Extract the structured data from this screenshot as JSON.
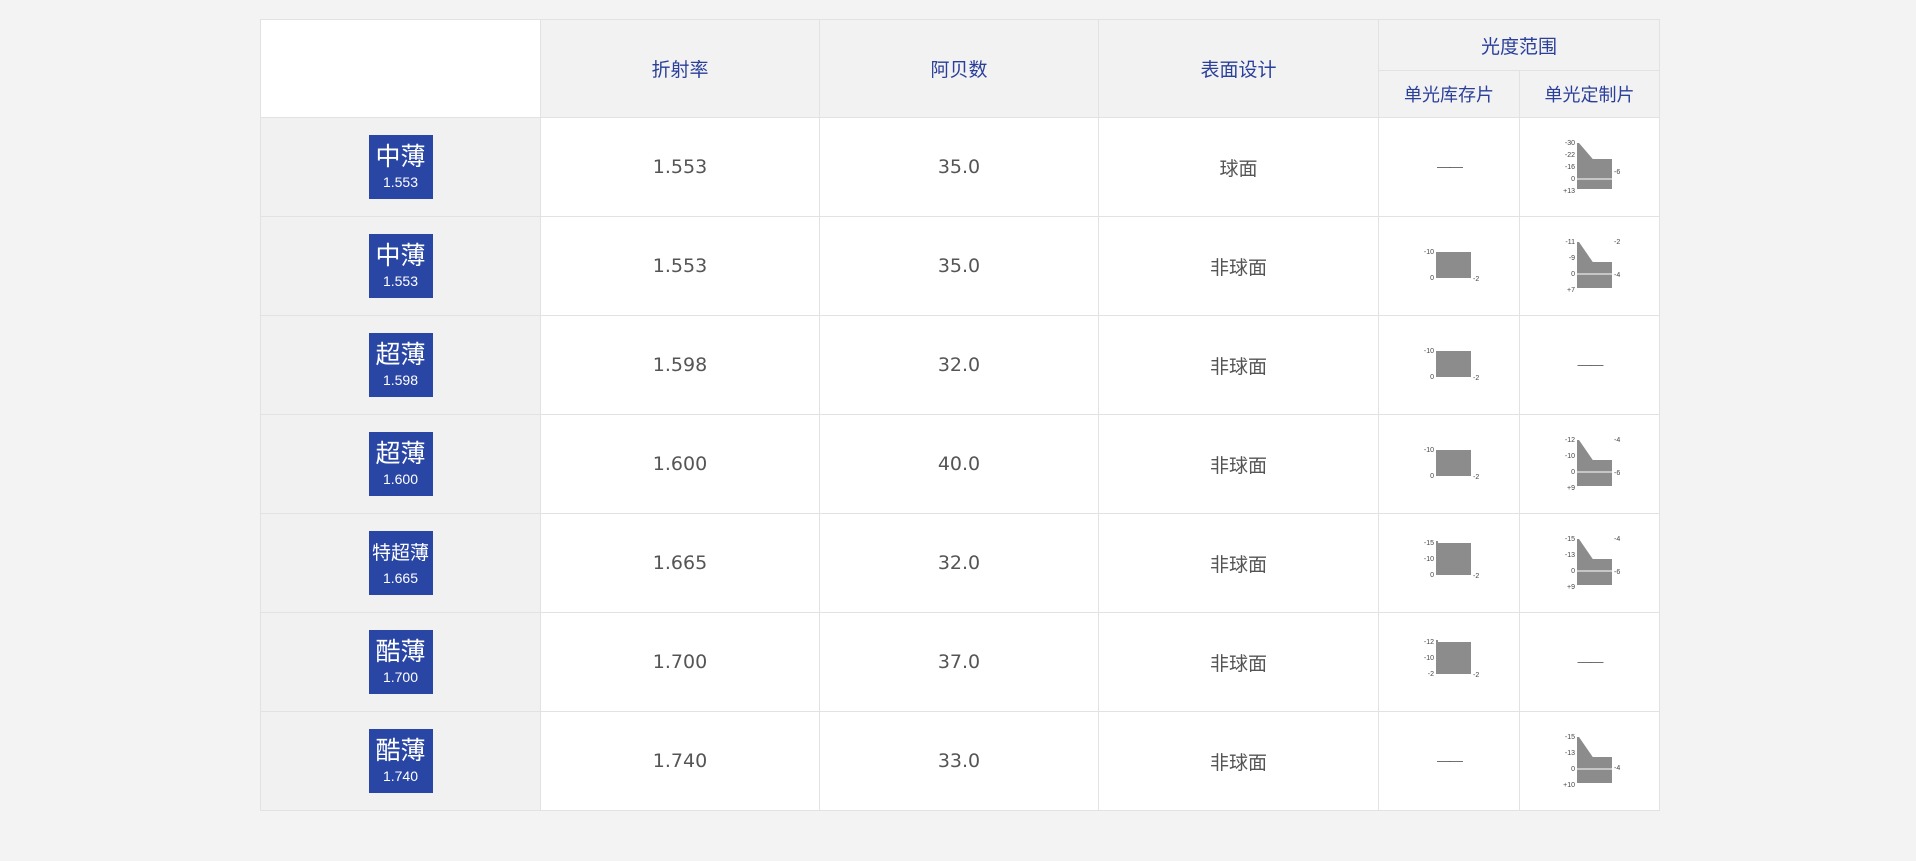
{
  "header": {
    "col_refractive": "折射率",
    "col_abbe": "阿贝数",
    "col_surface": "表面设计",
    "col_power_range": "光度范围",
    "col_stock": "单光库存片",
    "col_custom": "单光定制片"
  },
  "rows": [
    {
      "lens_name": "中薄",
      "lens_index": "1.553",
      "refractive": "1.553",
      "abbe": "35.0",
      "surface": "球面",
      "stock": null,
      "custom": {
        "left": [
          "-30",
          "-22",
          "-16",
          "0",
          "+13"
        ],
        "right": [
          "-6"
        ]
      }
    },
    {
      "lens_name": "中薄",
      "lens_index": "1.553",
      "refractive": "1.553",
      "abbe": "35.0",
      "surface": "非球面",
      "stock": {
        "left": [
          "-10",
          "0"
        ],
        "right": [
          "-2"
        ]
      },
      "custom": {
        "left": [
          "-11",
          "-9",
          "0",
          "+7"
        ],
        "right": [
          "-2",
          "-4"
        ]
      }
    },
    {
      "lens_name": "超薄",
      "lens_index": "1.598",
      "refractive": "1.598",
      "abbe": "32.0",
      "surface": "非球面",
      "stock": {
        "left": [
          "-10",
          "0"
        ],
        "right": [
          "-2"
        ]
      },
      "custom": null
    },
    {
      "lens_name": "超薄",
      "lens_index": "1.600",
      "refractive": "1.600",
      "abbe": "40.0",
      "surface": "非球面",
      "stock": {
        "left": [
          "-10",
          "0"
        ],
        "right": [
          "-2"
        ]
      },
      "custom": {
        "left": [
          "-12",
          "-10",
          "0",
          "+9"
        ],
        "right": [
          "-4",
          "-6"
        ]
      }
    },
    {
      "lens_name": "特超薄",
      "lens_index": "1.665",
      "refractive": "1.665",
      "abbe": "32.0",
      "surface": "非球面",
      "stock": {
        "left": [
          "-15",
          "-10",
          "0"
        ],
        "right": [
          "-2"
        ]
      },
      "custom": {
        "left": [
          "-15",
          "-13",
          "0",
          "+9"
        ],
        "right": [
          "-4",
          "-6"
        ]
      }
    },
    {
      "lens_name": "酷薄",
      "lens_index": "1.700",
      "refractive": "1.700",
      "abbe": "37.0",
      "surface": "非球面",
      "stock": {
        "left": [
          "-12",
          "-10",
          "-2"
        ],
        "right": [
          "-2"
        ]
      },
      "custom": null
    },
    {
      "lens_name": "酷薄",
      "lens_index": "1.740",
      "refractive": "1.740",
      "abbe": "33.0",
      "surface": "非球面",
      "stock": null,
      "custom": {
        "left": [
          "-15",
          "-13",
          "0",
          "+10"
        ],
        "right": [
          "-4"
        ]
      }
    }
  ],
  "empty_cell": "——",
  "colors": {
    "header_text": "#2a3f9a",
    "badge_bg": "#2946a5",
    "range_fill": "#8c8c8c",
    "row_label_bg": "#f1f1f1",
    "header_bg": "#f2f2f2"
  }
}
